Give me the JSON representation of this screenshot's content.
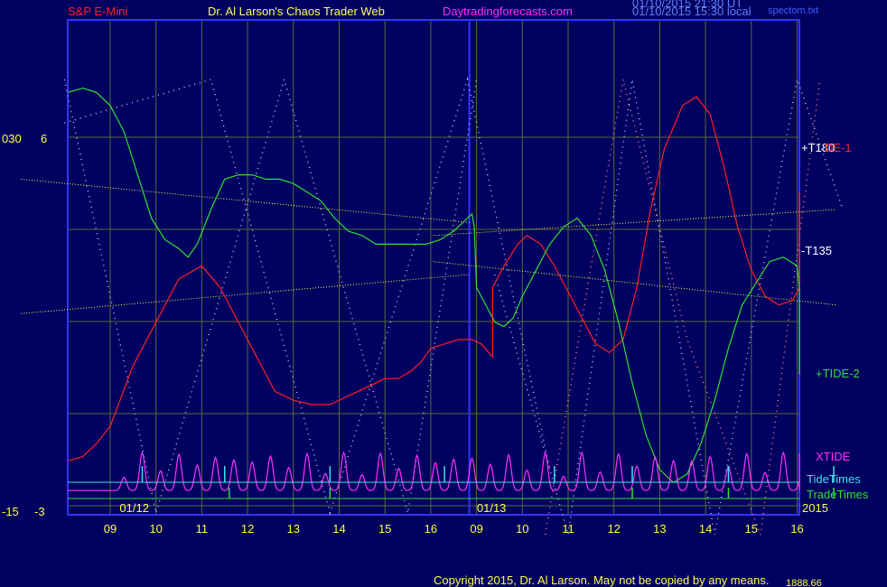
{
  "header": {
    "instrument": "S&P E-Mini",
    "site": "Dr. Al Larson's Chaos Trader Web",
    "url": "Daytradingforecasts.com",
    "stamp1": "01/10/2015 21:30 UT",
    "stamp2": "01/10/2015 15:30 local",
    "file": "spectom.txt"
  },
  "footer": {
    "copyright": "Copyright 2015, Dr. Al Larson. May not be copied by any means.",
    "value": "1888.66"
  },
  "left_labels": {
    "top_a": "030",
    "top_b": "6",
    "bot_a": "-15",
    "bot_b": "-3"
  },
  "colors": {
    "background": "#000060",
    "frame": "#3333ff",
    "grid": "#5a6a3a",
    "yellow": "#ffff40",
    "red": "#ff2020",
    "green": "#30e030",
    "magenta": "#ff30ff",
    "cyan": "#40e0f0",
    "white": "#ffffff",
    "header_red": "#ff2020",
    "header_magenta": "#ff30ff",
    "header_blue": "#6080ff"
  },
  "chart_data": {
    "type": "line",
    "x_ticks": [
      "09",
      "10",
      "11",
      "12",
      "13",
      "14",
      "15",
      "16",
      "09",
      "10",
      "11",
      "12",
      "13",
      "14",
      "15",
      "16"
    ],
    "date_labels": [
      {
        "label": "01/12",
        "at": 0.6
      },
      {
        "label": "01/13",
        "at": 8.4
      }
    ],
    "year_label": "2015",
    "x_range": [
      -1,
      16
    ],
    "y_range": [
      0,
      100
    ],
    "session_break": 8,
    "series": [
      {
        "name": "+TIDE-1",
        "color": "red",
        "points": [
          [
            -1,
            12
          ],
          [
            -0.6,
            13
          ],
          [
            -0.3,
            16
          ],
          [
            0,
            20
          ],
          [
            0.5,
            34
          ],
          [
            1,
            44
          ],
          [
            1.5,
            54
          ],
          [
            2,
            57
          ],
          [
            2.4,
            52
          ],
          [
            2.8,
            44
          ],
          [
            3.2,
            36
          ],
          [
            3.6,
            28
          ],
          [
            4,
            26
          ],
          [
            4.4,
            25
          ],
          [
            4.8,
            25
          ],
          [
            5.2,
            27
          ],
          [
            5.6,
            29
          ],
          [
            6,
            31
          ],
          [
            6.3,
            31
          ],
          [
            6.6,
            33
          ],
          [
            6.8,
            35
          ],
          [
            7,
            38
          ],
          [
            7.3,
            39
          ],
          [
            7.6,
            40
          ],
          [
            7.9,
            40
          ],
          [
            8.1,
            39
          ],
          [
            8.35,
            36
          ],
          [
            8.35,
            52
          ],
          [
            8.6,
            57
          ],
          [
            8.9,
            62
          ],
          [
            9.1,
            64
          ],
          [
            9.4,
            62
          ],
          [
            9.7,
            57
          ],
          [
            10,
            51
          ],
          [
            10.3,
            45
          ],
          [
            10.6,
            39
          ],
          [
            10.9,
            37
          ],
          [
            11.2,
            40
          ],
          [
            11.5,
            52
          ],
          [
            11.8,
            70
          ],
          [
            12.1,
            84
          ],
          [
            12.5,
            94
          ],
          [
            12.8,
            96
          ],
          [
            13.1,
            92
          ],
          [
            13.4,
            80
          ],
          [
            13.7,
            66
          ],
          [
            14,
            56
          ],
          [
            14.3,
            50
          ],
          [
            14.6,
            48
          ],
          [
            14.9,
            49
          ],
          [
            15.2,
            52
          ],
          [
            15.5,
            60
          ],
          [
            15.8,
            69
          ],
          [
            16,
            74
          ]
        ]
      },
      {
        "name": "+TIDE-2",
        "color": "green",
        "points": [
          [
            -1,
            97
          ],
          [
            -0.6,
            98
          ],
          [
            -0.3,
            97
          ],
          [
            0,
            94
          ],
          [
            0.3,
            88
          ],
          [
            0.6,
            78
          ],
          [
            0.9,
            68
          ],
          [
            1.2,
            63
          ],
          [
            1.5,
            61
          ],
          [
            1.7,
            59
          ],
          [
            1.9,
            62
          ],
          [
            2.2,
            70
          ],
          [
            2.5,
            77
          ],
          [
            2.8,
            78
          ],
          [
            3.1,
            78
          ],
          [
            3.4,
            77
          ],
          [
            3.7,
            77
          ],
          [
            4,
            76
          ],
          [
            4.3,
            74
          ],
          [
            4.6,
            72
          ],
          [
            4.9,
            68
          ],
          [
            5.2,
            65
          ],
          [
            5.5,
            64
          ],
          [
            5.8,
            62
          ],
          [
            6.2,
            62
          ],
          [
            6.6,
            62
          ],
          [
            6.9,
            62
          ],
          [
            7.2,
            63
          ],
          [
            7.5,
            65
          ],
          [
            7.7,
            67
          ],
          [
            7.9,
            69
          ],
          [
            7.95,
            66
          ],
          [
            8.0,
            52
          ],
          [
            8.2,
            48
          ],
          [
            8.4,
            44
          ],
          [
            8.6,
            43
          ],
          [
            8.8,
            45
          ],
          [
            9,
            50
          ],
          [
            9.3,
            56
          ],
          [
            9.6,
            62
          ],
          [
            9.9,
            66
          ],
          [
            10.2,
            68
          ],
          [
            10.5,
            64
          ],
          [
            10.8,
            56
          ],
          [
            11.1,
            44
          ],
          [
            11.4,
            30
          ],
          [
            11.7,
            18
          ],
          [
            12,
            10
          ],
          [
            12.3,
            7
          ],
          [
            12.6,
            9
          ],
          [
            12.9,
            16
          ],
          [
            13.2,
            26
          ],
          [
            13.5,
            38
          ],
          [
            13.8,
            48
          ],
          [
            14.1,
            53
          ],
          [
            14.4,
            58
          ],
          [
            14.7,
            59
          ],
          [
            15,
            57
          ],
          [
            15.3,
            52
          ],
          [
            15.6,
            44
          ],
          [
            15.9,
            35
          ],
          [
            16,
            32
          ]
        ]
      },
      {
        "name": "XTIDE",
        "color": "magenta",
        "baseline": -8,
        "amplitude": 10,
        "peaks": [
          0.3,
          0.7,
          1.1,
          1.5,
          1.9,
          2.3,
          2.7,
          3.1,
          3.5,
          3.9,
          4.3,
          4.7,
          5.1,
          5.5,
          5.9,
          6.3,
          6.7,
          7.1,
          7.5,
          7.9,
          8.3,
          8.7,
          9.1,
          9.5,
          9.9,
          10.3,
          10.7,
          11.1,
          11.5,
          11.9,
          12.3,
          12.7,
          13.1,
          13.5,
          13.9,
          14.3,
          14.7,
          15.1,
          15.5,
          15.9
        ]
      }
    ],
    "yellow_lines": [
      {
        "from": [
          -1,
          77
        ],
        "to": [
          8,
          67
        ]
      },
      {
        "from": [
          -1,
          46
        ],
        "to": [
          8,
          55
        ]
      },
      {
        "from": [
          8,
          64
        ],
        "to": [
          16,
          70
        ]
      },
      {
        "from": [
          8,
          58
        ],
        "to": [
          16,
          48
        ]
      }
    ],
    "right_labels": [
      {
        "label": "+T180",
        "color": "white",
        "y": 70
      },
      {
        "label": "DE-1",
        "color": "red",
        "y": 70
      },
      {
        "label": "-T135",
        "color": "white",
        "y": 48
      },
      {
        "label": "+TIDE-2",
        "color": "green",
        "y": 29
      },
      {
        "label": "XTIDE",
        "color": "magenta",
        "y": 1
      },
      {
        "label": "TideTimes",
        "color": "cyan",
        "y": -8
      },
      {
        "label": "TradeTimes",
        "color": "green",
        "y": -11
      }
    ],
    "tide_times": [
      0.7,
      2.5,
      4.8,
      7.3,
      9.7,
      11.4,
      13.5,
      15.8
    ],
    "trade_times": [
      2.6,
      4.8,
      11.4,
      13.5,
      15.8
    ],
    "tide_level": -8,
    "trade_level": -11
  }
}
